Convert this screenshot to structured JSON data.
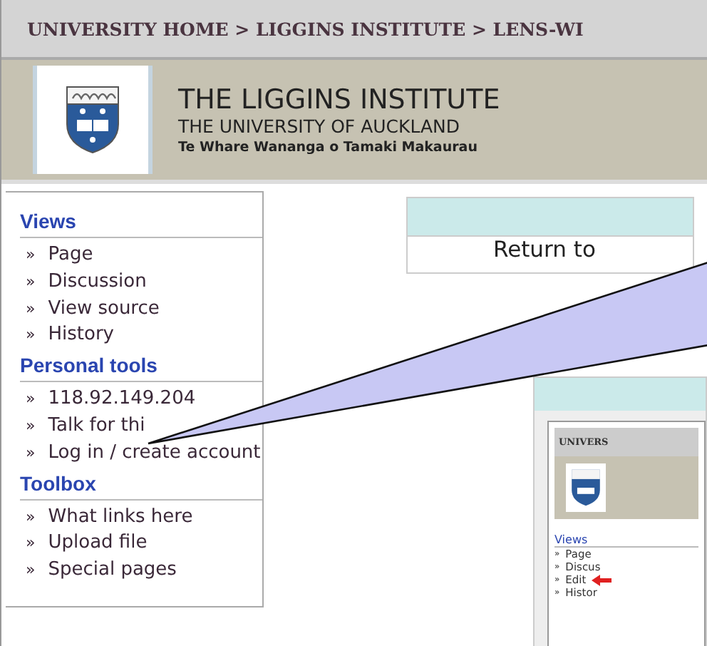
{
  "breadcrumb": "UNIVERSITY HOME > LIGGINS INSTITUTE > LENS-WI",
  "header": {
    "title": "THE LIGGINS INSTITUTE",
    "subtitle": "THE UNIVERSITY OF AUCKLAND",
    "motto": "Te Whare Wananga o Tamaki Makaurau"
  },
  "sidebar": [
    {
      "heading": "Views",
      "items": [
        {
          "bullet": "»",
          "label": "Page"
        },
        {
          "bullet": "»",
          "label": "Discussion"
        },
        {
          "bullet": "»",
          "label": "View source"
        },
        {
          "bullet": "»",
          "label": "History"
        }
      ]
    },
    {
      "heading": "Personal tools",
      "items": [
        {
          "bullet": "»",
          "label": "118.92.149.204"
        },
        {
          "bullet": "»",
          "label": "Talk for thi"
        },
        {
          "bullet": "»",
          "label": "Log in / create account"
        }
      ]
    },
    {
      "heading": "Toolbox",
      "items": [
        {
          "bullet": "»",
          "label": "What links here"
        },
        {
          "bullet": "»",
          "label": "Upload file"
        },
        {
          "bullet": "»",
          "label": "Special pages"
        }
      ]
    }
  ],
  "notice": {
    "text": "Return to"
  },
  "inset": {
    "breadcrumb": "UNIVERS",
    "heading": "Views",
    "items": [
      {
        "bullet": "»",
        "label": "Page",
        "marked": false
      },
      {
        "bullet": "»",
        "label": "Discus",
        "marked": false
      },
      {
        "bullet": "»",
        "label": "Edit",
        "marked": true
      },
      {
        "bullet": "»",
        "label": "Histor",
        "marked": false
      }
    ]
  }
}
